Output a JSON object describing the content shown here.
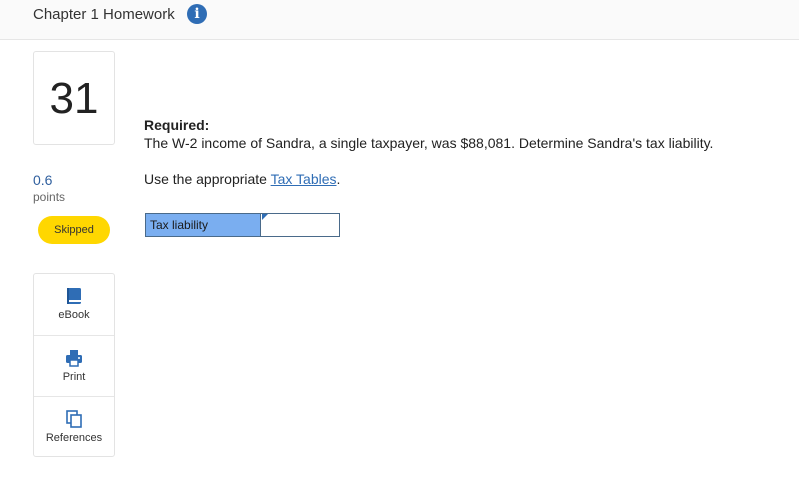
{
  "header": {
    "title": "Chapter 1 Homework",
    "info_icon": "info-icon"
  },
  "question": {
    "number": "31",
    "points_value": "0.6",
    "points_label": "points",
    "status": "Skipped",
    "status_color": "#ffd700",
    "required_label": "Required:",
    "text": "The W-2 income of Sandra, a single taxpayer, was $88,081. Determine Sandra's tax liability.",
    "instruction_prefix": "Use the appropriate ",
    "instruction_link": "Tax Tables",
    "instruction_suffix": "."
  },
  "answer": {
    "label": "Tax liability",
    "value": ""
  },
  "tools": [
    {
      "label": "eBook",
      "icon": "book-icon"
    },
    {
      "label": "Print",
      "icon": "printer-icon"
    },
    {
      "label": "References",
      "icon": "copy-icon"
    }
  ],
  "colors": {
    "accent": "#2f6db5",
    "answer_label_bg": "#7aaef0"
  }
}
